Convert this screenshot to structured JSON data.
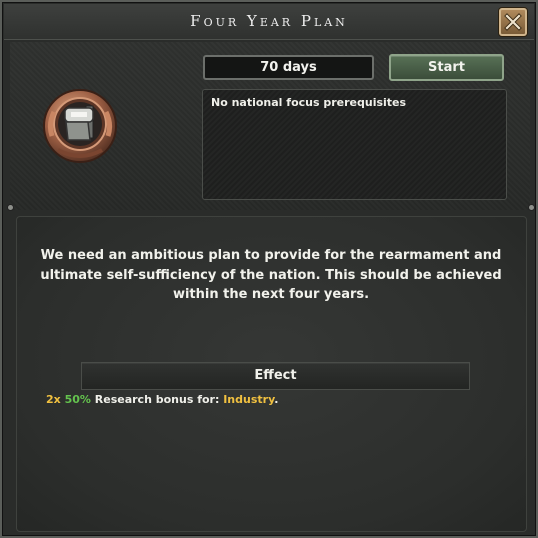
{
  "window": {
    "title": "Four Year Plan"
  },
  "focus": {
    "duration": "70 days",
    "start_label": "Start",
    "prerequisites": "No national focus prerequisites",
    "icon": "fist-hammer-emblem-icon",
    "description": "We need an ambitious plan to provide for the rearmament and ultimate self-sufficiency of the nation. This should be achieved within the next four years."
  },
  "effect": {
    "header": "Effect",
    "multiplier": "2x",
    "percent": "50%",
    "text": " Research bonus for: ",
    "category": "Industry",
    "suffix": "."
  },
  "colors": {
    "accent_green": "#64c34e",
    "accent_yellow": "#f0c040",
    "start_button": "#4a6148"
  }
}
